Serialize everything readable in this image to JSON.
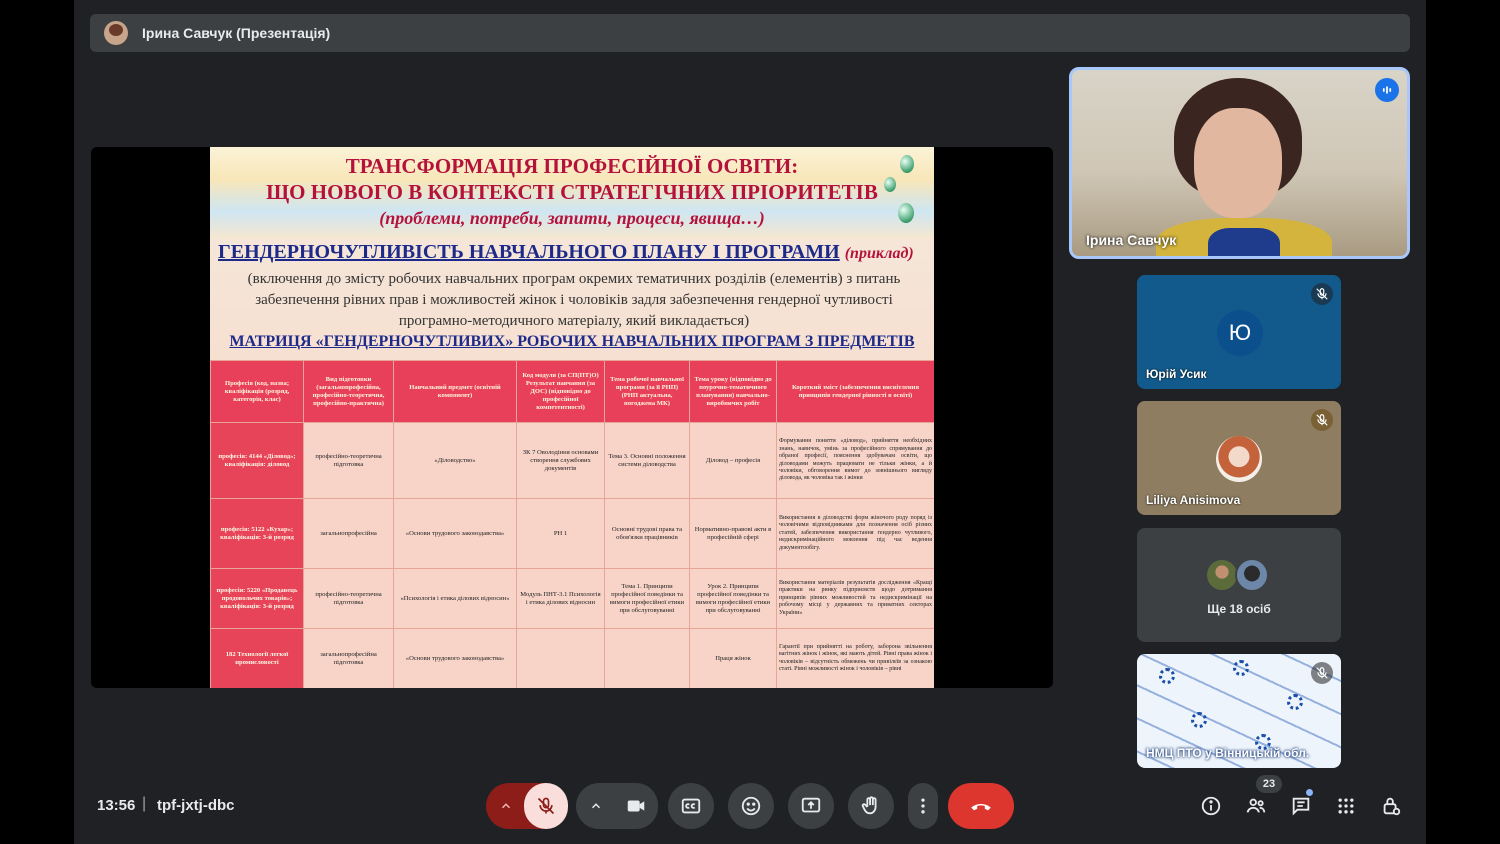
{
  "presenter_bar": {
    "label": "Ірина Савчук (Презентація)"
  },
  "slide": {
    "title_line1": "ТРАНСФОРМАЦІЯ ПРОФЕСІЙНОЇ ОСВІТИ:",
    "title_line2": "ЩО НОВОГО В КОНТЕКСТІ СТРАТЕГІЧНИХ ПРІОРИТЕТІВ",
    "subtitle": "(проблеми, потреби, запити, процеси, явища…)",
    "heading": "ГЕНДЕРНОЧУТЛИВІСТЬ НАВЧАЛЬНОГО ПЛАНУ І ПРОГРАМИ",
    "heading_example": "(приклад)",
    "description": "(включення до змісту робочих навчальних програм окремих тематичних розділів (елементів) з питань забезпечення рівних прав і можливостей жінок і чоловіків задля забезпечення гендерної чутливості програмно-методичного матеріалу, який викладається)",
    "matrix_title": "МАТРИЦЯ «ГЕНДЕРНОЧУТЛИВИХ» РОБОЧИХ НАВЧАЛЬНИХ ПРОГРАМ З ПРЕДМЕТІВ",
    "table": {
      "headers": [
        "Професія (код, назва; кваліфікація (розряд, категорія, клас)",
        "Вид підготовки (загальнопрофесійна, професійно-теоретична, професійно-практична)",
        "Навчальний предмет (освітній компонент)",
        "Код модуля (за СП(ПТ)О) Результат навчання (за ДОС) (відповідно до професійної компетентності)",
        "Тема робочої навчальної програми (за її РНП) (РНП актуальна, погоджена МК)",
        "Тема уроку (відповідно до поурочно-тематичного планування) навчально-виробничих робіт",
        "Короткий зміст (забезпечення висвітлення принципів гендерної рівності в освіті)"
      ],
      "rows": [
        [
          "професія: 4144 «Діловод»; кваліфікація: діловод",
          "професійно-теоретична підготовка",
          "«Діловодство»",
          "ЗК 7 Оволодіння основами створення службових документів",
          "Тема 3. Основні положення системи діловодства",
          "Діловод – професія",
          "Формування поняття «діловод», прийняття необхідних знань, навичок, умінь за професійного спрямування до обраної професії, пояснення здобувачам освіти, що діловодами можуть працювати не тільки жінки, а й чоловіки, обговорення вимог до зовнішнього вигляду діловода, як чоловіка так і жінки"
        ],
        [
          "професія: 5122 «Кухар»; кваліфікація: 3-й розряд",
          "загальнопрофесійна",
          "«Основи трудового законодавства»",
          "РН 1",
          "Основні трудові права та обов'язки працівників",
          "Нормативно-правові акти в професійній сфері",
          "Використання в діловодстві форм жіночого роду поряд із чоловічими відповідниками для позначення осіб різних статей, забезпечення використання гендерно чутливого, недискримінаційного мовлення під час ведення документообігу."
        ],
        [
          "професія: 5220 «Продавець продовольчих товарів»; кваліфікація: 3-й розряд",
          "професійно-теоретична підготовка",
          "«Психологія і етика ділових відносин»",
          "Модуль ПНТ-3.1 Психологія і етика ділових відносин",
          "Тема 1. Принципи професійної поведінки та вимоги професійної етики при обслуговуванні",
          "Урок 2. Принципи професійної поведінки та вимоги професійної етики при обслуговуванні",
          "Використання матеріалів результатів дослідження «Кращі практики на ринку підприємств щодо дотримання принципів рівних можливостей та недискримінації на робочому місці у державних та приватних секторах України»"
        ],
        [
          "182 Технології легкої промисловості",
          "загальнопрофесійна підготовка",
          "«Основи трудового законодавства»",
          "",
          "",
          "Праця жінок",
          "Гарантії при прийнятті на роботу, заборона звільнення вагітних жінок і жінок, які мають дітей. Рівні права жінок і чоловіків – відсутність обмежень чи привілеїв за ознакою статі. Рівні можливості жінок і чоловіків – рівні"
        ]
      ]
    }
  },
  "self_tile": {
    "name": "Ірина Савчук"
  },
  "participants": [
    {
      "name": "Юрій Усик",
      "initial": "Ю"
    },
    {
      "name": "Liliya Anisimova"
    },
    {
      "name": "Ще 18 осіб"
    },
    {
      "name": "НМЦ ПТО у Вінницькій обл."
    }
  ],
  "bottom_bar": {
    "time": "13:56",
    "separator": "|",
    "meeting_code": "tpf-jxtj-dbc",
    "people_count": "23"
  },
  "colors": {
    "background": "#202124",
    "surface": "#3c4043",
    "mic_off": "#8c1d18",
    "leave": "#dc362e",
    "accent": "#a8c7fa",
    "slide_red": "#b5123b",
    "slide_blue": "#1e2a8a"
  },
  "icons": {
    "mic": "mic-off-icon",
    "camera": "video-camera-icon",
    "captions": "closed-captions-icon",
    "emoji": "emoji-icon",
    "present": "present-screen-icon",
    "hand": "raise-hand-icon",
    "more": "more-vert-icon",
    "leave": "call-end-icon",
    "info": "info-icon",
    "people": "people-icon",
    "chat": "chat-icon",
    "activities": "apps-grid-icon",
    "host": "host-controls-lock-icon"
  }
}
